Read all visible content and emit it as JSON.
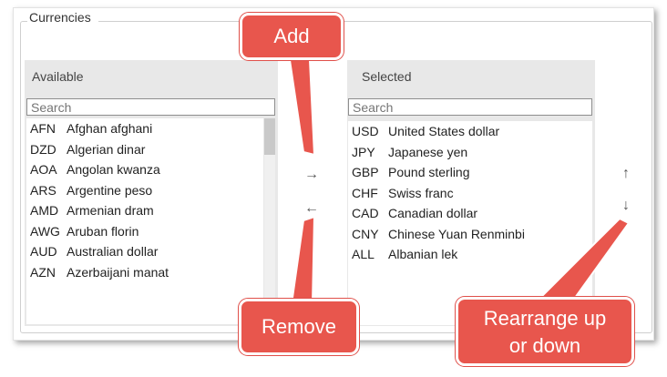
{
  "group_title": "Currencies",
  "available": {
    "header": "Available",
    "search_placeholder": "Search",
    "items": [
      {
        "code": "AFN",
        "name": "Afghan afghani"
      },
      {
        "code": "DZD",
        "name": "Algerian dinar"
      },
      {
        "code": "AOA",
        "name": "Angolan kwanza"
      },
      {
        "code": "ARS",
        "name": "Argentine peso"
      },
      {
        "code": "AMD",
        "name": "Armenian dram"
      },
      {
        "code": "AWG",
        "name": "Aruban florin"
      },
      {
        "code": "AUD",
        "name": "Australian dollar"
      },
      {
        "code": "AZN",
        "name": "Azerbaijani manat"
      }
    ]
  },
  "selected": {
    "header": "Selected",
    "search_placeholder": "Search",
    "items": [
      {
        "code": "USD",
        "name": "United States dollar"
      },
      {
        "code": "JPY",
        "name": "Japanese yen"
      },
      {
        "code": "GBP",
        "name": "Pound sterling"
      },
      {
        "code": "CHF",
        "name": "Swiss franc"
      },
      {
        "code": "CAD",
        "name": "Canadian dollar"
      },
      {
        "code": "CNY",
        "name": "Chinese Yuan Renminbi"
      },
      {
        "code": "ALL",
        "name": "Albanian lek"
      }
    ]
  },
  "buttons": {
    "add": "→",
    "remove": "←",
    "move_up": "↑",
    "move_down": "↓"
  },
  "callouts": {
    "add": "Add",
    "remove": "Remove",
    "rearrange_line1": "Rearrange up",
    "rearrange_line2": "or down"
  },
  "colors": {
    "callout": "#e8564d",
    "panel_header": "#e8e8e8"
  }
}
